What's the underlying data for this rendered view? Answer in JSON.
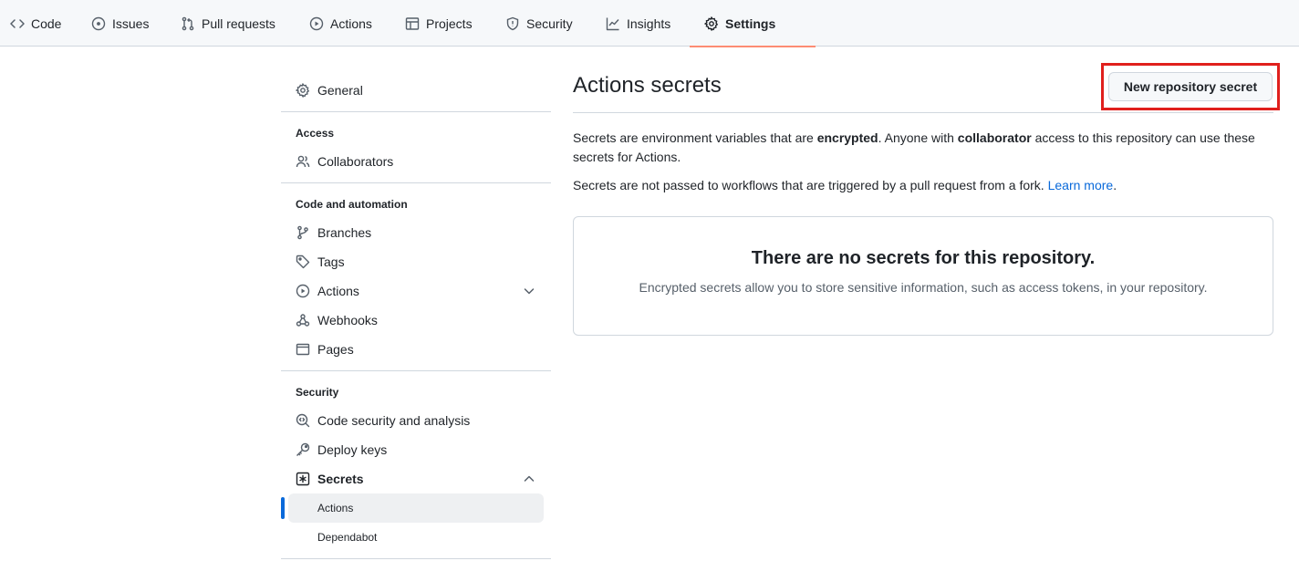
{
  "nav": {
    "tabs": [
      {
        "label": "Code",
        "icon": "code-icon"
      },
      {
        "label": "Issues",
        "icon": "issue-icon"
      },
      {
        "label": "Pull requests",
        "icon": "pull-request-icon"
      },
      {
        "label": "Actions",
        "icon": "play-icon"
      },
      {
        "label": "Projects",
        "icon": "table-icon"
      },
      {
        "label": "Security",
        "icon": "shield-icon"
      },
      {
        "label": "Insights",
        "icon": "graph-icon"
      },
      {
        "label": "Settings",
        "icon": "gear-icon",
        "active": true
      }
    ]
  },
  "sidebar": {
    "general": "General",
    "access_heading": "Access",
    "collaborators": "Collaborators",
    "code_heading": "Code and automation",
    "branches": "Branches",
    "tags": "Tags",
    "actions": "Actions",
    "webhooks": "Webhooks",
    "pages": "Pages",
    "security_heading": "Security",
    "code_security": "Code security and analysis",
    "deploy_keys": "Deploy keys",
    "secrets": "Secrets",
    "secrets_actions": "Actions",
    "secrets_dependabot": "Dependabot"
  },
  "main": {
    "title": "Actions secrets",
    "new_button": "New repository secret",
    "para1_a": "Secrets are environment variables that are ",
    "para1_b": "encrypted",
    "para1_c": ". Anyone with ",
    "para1_d": "collaborator",
    "para1_e": " access to this repository can use these secrets for Actions.",
    "para2_a": "Secrets are not passed to workflows that are triggered by a pull request from a fork. ",
    "para2_link": "Learn more",
    "para2_b": ".",
    "empty_title": "There are no secrets for this repository.",
    "empty_desc": "Encrypted secrets allow you to store sensitive information, such as access tokens, in your repository."
  },
  "colors": {
    "accent": "#0969da",
    "tab_underline": "#fd8c73",
    "highlight_box": "#e0201d"
  }
}
